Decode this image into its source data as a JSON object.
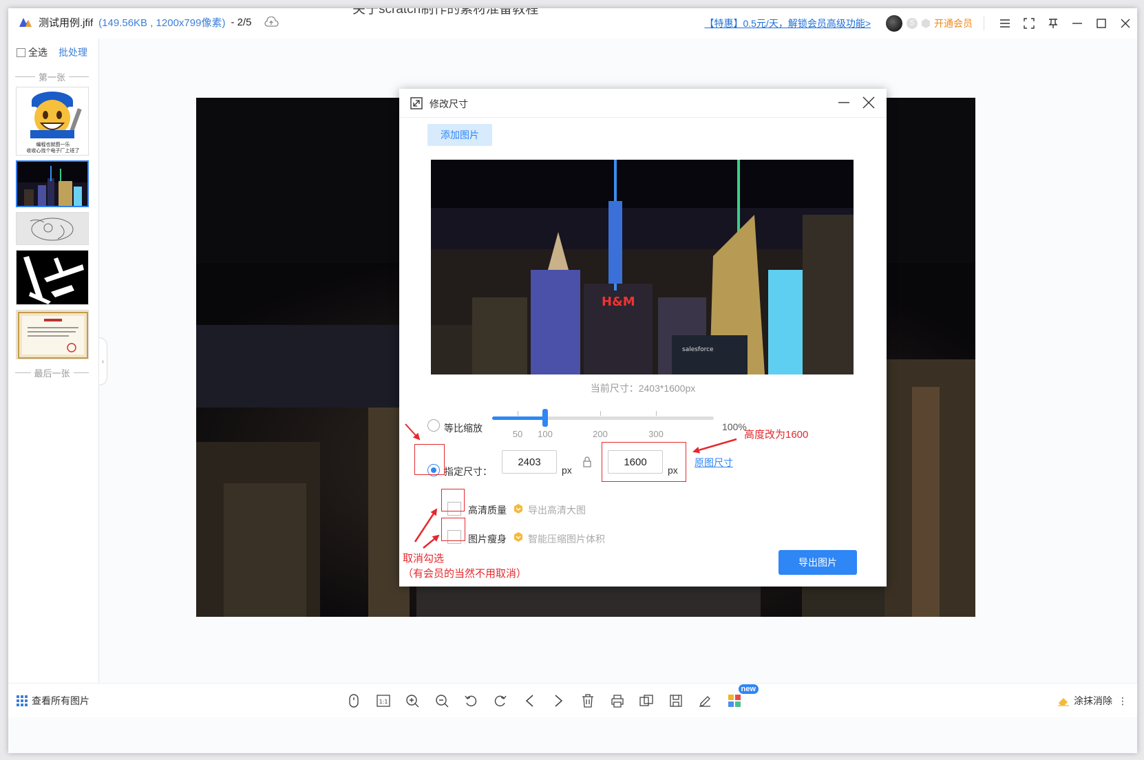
{
  "window": {
    "ghost_title": "关于scratch制作的素材准备教程",
    "file_name": "测试用例.jfif",
    "file_meta": "(149.56KB , 1200x799像素)",
    "page_counter": "- 2/5",
    "promo_text": "【特惠】0.5元/天，解锁会员高级功能>",
    "vip_label": "开通会员",
    "badge_s": "S"
  },
  "sidebar": {
    "select_all": "全选",
    "batch": "批处理",
    "first_label": "第一张",
    "last_label": "最后一张",
    "thumb1_caption_line1": "编程也就图一乐",
    "thumb1_caption_line2": "收收心找个电子厂上班了",
    "collapse_glyph": "‹"
  },
  "bottombar": {
    "view_all": "查看所有图片",
    "new_badge": "new",
    "erase": "涂抹消除",
    "more_glyph": "⋮"
  },
  "dialog": {
    "title": "修改尺寸",
    "add_image": "添加图片",
    "current_size": "当前尺寸：2403*1600px",
    "scale_label": "等比缩放",
    "scale_value": "100%",
    "scale_percent": 100,
    "scale_ticks": [
      "50",
      "100",
      "200",
      "300"
    ],
    "specify_label": "指定尺寸：",
    "width_value": "2403",
    "height_value": "1600",
    "unit": "px",
    "original_size_link": "原图尺寸",
    "hd_label": "高清质量",
    "hd_hint": "导出高清大图",
    "slim_label": "图片瘦身",
    "slim_hint": "智能压缩图片体积",
    "export_button": "导出图片",
    "preview_sign1": "H&M",
    "preview_sign2": "salesforce"
  },
  "annotations": {
    "height_note": "高度改为1600",
    "uncheck_note": "取消勾选",
    "uncheck_note2": "（有会员的当然不用取消）"
  },
  "colors": {
    "accent": "#2f86f5",
    "annotation": "#e5282c",
    "vip": "#f08a1e"
  }
}
